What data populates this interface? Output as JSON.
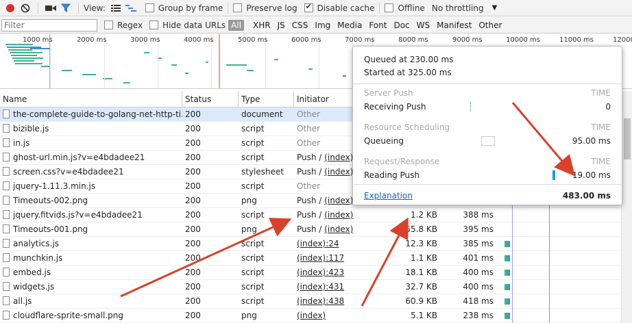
{
  "toolbar": {
    "view_label": "View:",
    "group_by_frame": "Group by frame",
    "preserve_log": "Preserve log",
    "disable_cache": "Disable cache",
    "offline": "Offline",
    "throttling": "No throttling",
    "disable_cache_checked": true
  },
  "filter": {
    "placeholder": "Filter",
    "regex": "Regex",
    "hide_data_urls": "Hide data URLs",
    "types": [
      "All",
      "XHR",
      "JS",
      "CSS",
      "Img",
      "Media",
      "Font",
      "Doc",
      "WS",
      "Manifest",
      "Other"
    ]
  },
  "overview": {
    "ticks": [
      "1000 ms",
      "2000 ms",
      "3000 ms",
      "4000 ms",
      "5000 ms",
      "6000 ms",
      "7000 ms",
      "8000 ms",
      "9000 ms",
      "10000 ms",
      "11000 ms",
      "12000 ms"
    ]
  },
  "columns": {
    "name": "Name",
    "status": "Status",
    "type": "Type",
    "initiator": "Initiator"
  },
  "rows": [
    {
      "name": "the-complete-guide-to-golang-net-http-ti...",
      "status": "200",
      "type": "document",
      "initiator": "Other",
      "size": "",
      "time": ""
    },
    {
      "name": "bizible.js",
      "status": "200",
      "type": "script",
      "initiator": "Other",
      "size": "",
      "time": ""
    },
    {
      "name": "in.js",
      "status": "200",
      "type": "script",
      "initiator": "Other",
      "size": "",
      "time": ""
    },
    {
      "name": "ghost-url.min.js?v=e4bdadee21",
      "status": "200",
      "type": "script",
      "initiator": "Push / (index)",
      "size": "",
      "time": ""
    },
    {
      "name": "screen.css?v=e4bdadee21",
      "status": "200",
      "type": "stylesheet",
      "initiator": "Push / (index)",
      "size": "",
      "time": ""
    },
    {
      "name": "jquery-1.11.3.min.js",
      "status": "200",
      "type": "script",
      "initiator": "Other",
      "size": "",
      "time": ""
    },
    {
      "name": "Timeouts-002.png",
      "status": "200",
      "type": "png",
      "initiator": "Push / (index)",
      "size": "",
      "time": ""
    },
    {
      "name": "jquery.fitvids.js?v=e4bdadee21",
      "status": "200",
      "type": "script",
      "initiator": "Push / (index)",
      "size": "1.2 KB",
      "time": "388 ms"
    },
    {
      "name": "Timeouts-001.png",
      "status": "200",
      "type": "png",
      "initiator": "Push / (index)",
      "size": "55.8 KB",
      "time": "395 ms"
    },
    {
      "name": "analytics.js",
      "status": "200",
      "type": "script",
      "initiator": "(index):24",
      "size": "12.3 KB",
      "time": "385 ms"
    },
    {
      "name": "munchkin.js",
      "status": "200",
      "type": "script",
      "initiator": "(index):117",
      "size": "1.1 KB",
      "time": "401 ms"
    },
    {
      "name": "embed.js",
      "status": "200",
      "type": "script",
      "initiator": "(index):423",
      "size": "18.1 KB",
      "time": "400 ms"
    },
    {
      "name": "widgets.js",
      "status": "200",
      "type": "script",
      "initiator": "(index):431",
      "size": "32.7 KB",
      "time": "400 ms"
    },
    {
      "name": "all.js",
      "status": "200",
      "type": "script",
      "initiator": "(index):438",
      "size": "60.9 KB",
      "time": "418 ms"
    },
    {
      "name": "cloudflare-sprite-small.png",
      "status": "200",
      "type": "png",
      "initiator": "(index)",
      "size": "5.1 KB",
      "time": "238 ms"
    }
  ],
  "popup": {
    "queued": "Queued at 230.00 ms",
    "started": "Started at 325.00 ms",
    "time_header": "TIME",
    "sections": [
      {
        "title": "Server Push",
        "label": "Receiving Push",
        "value": "0"
      },
      {
        "title": "Resource Scheduling",
        "label": "Queueing",
        "value": "95.00 ms"
      },
      {
        "title": "Request/Response",
        "label": "Reading Push",
        "value": "19.00 ms"
      }
    ],
    "explanation": "Explanation",
    "total": "483.00 ms"
  },
  "colors": {
    "record": "#d93025",
    "arrow": "#d9412a",
    "bar_blue": "#3a8fd8",
    "bar_green": "#3fb28b"
  }
}
